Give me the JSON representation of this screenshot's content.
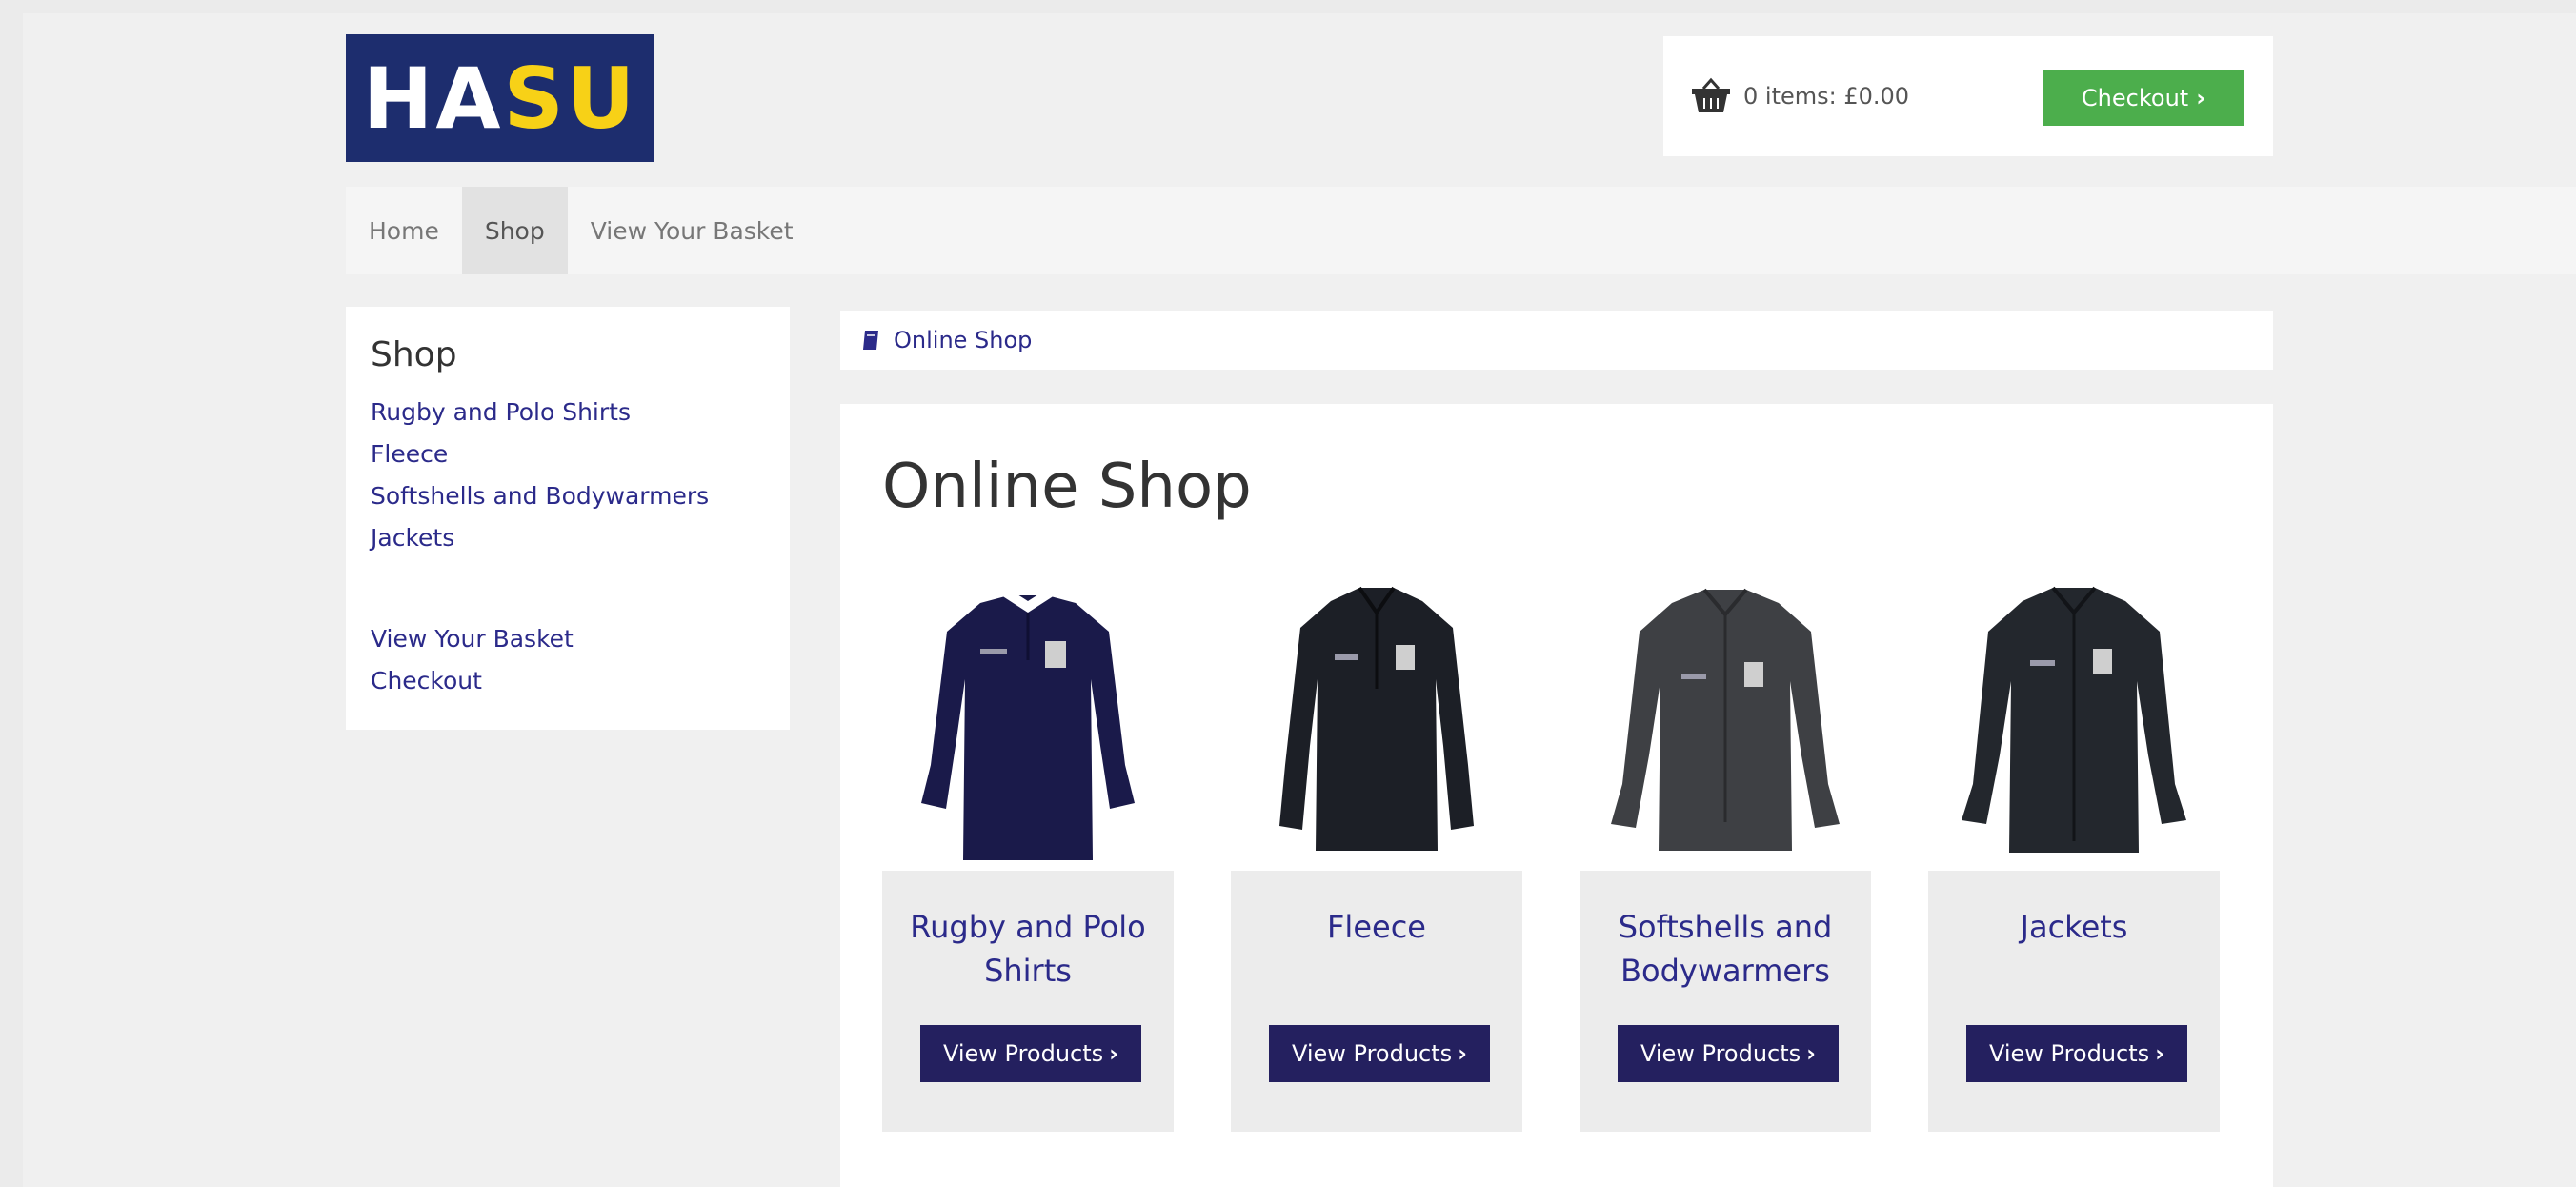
{
  "logo": {
    "part1": "HA",
    "part2": "SU"
  },
  "basket": {
    "summary": "0 items: £0.00",
    "checkout_label": "Checkout",
    "checkout_chevron": "›"
  },
  "nav": [
    {
      "label": "Home"
    },
    {
      "label": "Shop"
    },
    {
      "label": "View Your Basket"
    }
  ],
  "sidebar": {
    "heading": "Shop",
    "categories": [
      "Rugby and Polo Shirts",
      "Fleece",
      "Softshells and Bodywarmers",
      "Jackets"
    ],
    "links": [
      "View Your Basket",
      "Checkout"
    ]
  },
  "breadcrumb": {
    "label": "Online Shop"
  },
  "main": {
    "title": "Online Shop",
    "button_label": "View Products",
    "cards": [
      {
        "title": "Rugby and Polo Shirts",
        "garment_color": "#1a1a4a"
      },
      {
        "title": "Fleece",
        "garment_color": "#1c1f26"
      },
      {
        "title": "Softshells and Bodywarmers",
        "garment_color": "#3e4044"
      },
      {
        "title": "Jackets",
        "garment_color": "#23272d"
      }
    ]
  },
  "colors": {
    "brand_navy": "#1d2d6e",
    "brand_yellow": "#f7d117",
    "link": "#2b2a8a",
    "button": "#24205f",
    "checkout_green": "#4cae4c"
  }
}
